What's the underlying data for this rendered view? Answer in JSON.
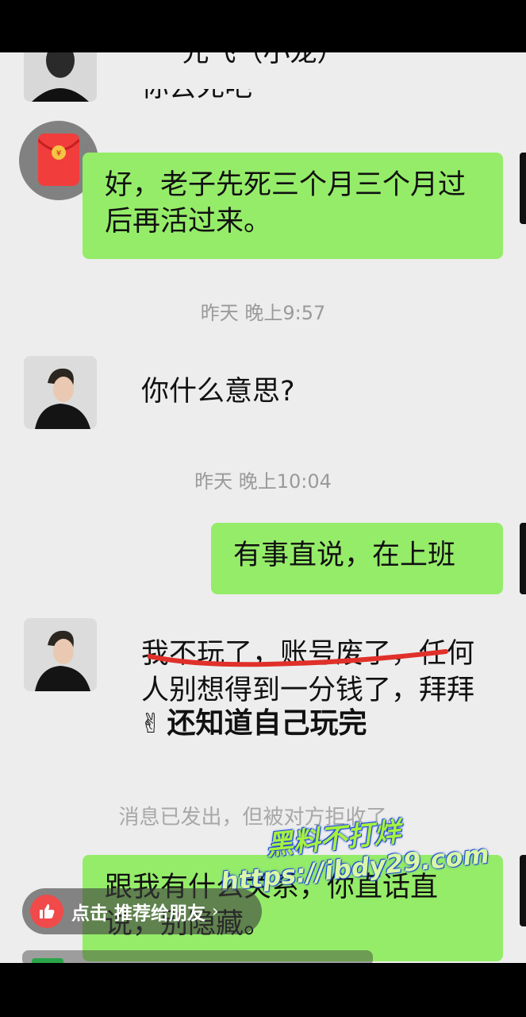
{
  "header": {
    "title": "元飞（小龙）"
  },
  "messages": {
    "partial_top": "你去死吧",
    "m1": "好，老子先死三个月三个月过后再活过来。",
    "ts1": "昨天 晚上9:57",
    "m2": "你什么意思?",
    "ts2": "昨天 晚上10:04",
    "m3": "有事直说，在上班",
    "m4_line1": "我不玩了，账号废了，任何",
    "m4_line2": "人别想得到一分钱了，拜拜",
    "m4_line3": "还知道自己玩完",
    "recall": "消息已发出，但被对方拒收了。",
    "m5": "跟我有什么关系，你直话直说，别隐藏。"
  },
  "overlay": {
    "like_label": "点击 推荐给朋友",
    "watermark_line1": "黑料不打烊",
    "watermark_line2": "https://ibdy29.com"
  },
  "colors": {
    "bubble_green": "#95ec69",
    "background": "#ededed",
    "underline": "#e0302a"
  },
  "icons": [
    "back-icon",
    "red-packet-icon",
    "thumbs-up-icon",
    "chevron-right-icon",
    "victory-emoji"
  ]
}
